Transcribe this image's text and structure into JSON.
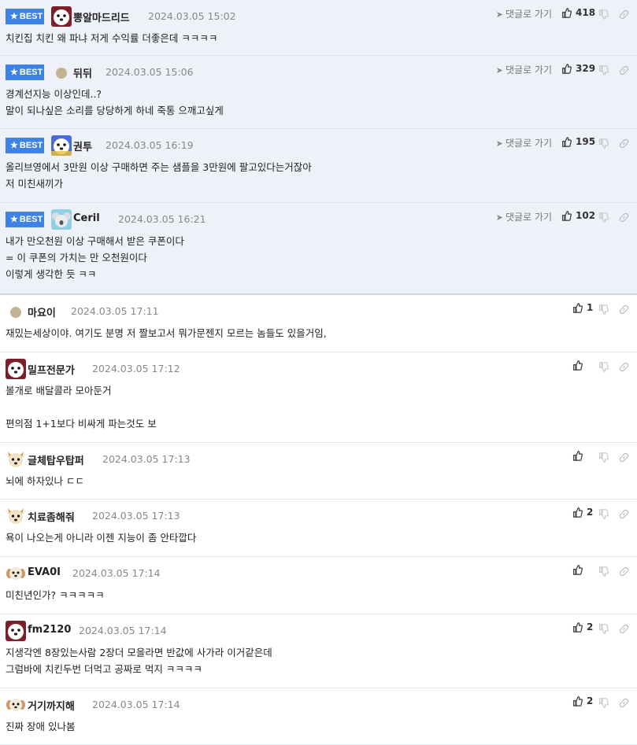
{
  "labels": {
    "best": "BEST",
    "reply": "댓글로 가기"
  },
  "colors": {
    "best_badge": "#3e82e4",
    "best_bg": "#eef2f8"
  },
  "best_comments": [
    {
      "nick": "뽕알마드리드",
      "date": "2024.03.05 15:02",
      "likes": "418",
      "avatar": "dog-avatar-white",
      "body": "치킨집 치킨 왜 파냐 저게 수익률 더좋은데 ㅋㅋㅋㅋ"
    },
    {
      "nick": "뒤뒤",
      "date": "2024.03.05 15:06",
      "likes": "329",
      "avatar": "default-dot-avatar",
      "body": "경계선지능 이상인데..?\n말이 되나싶은 소리를 당당하게 하네 죽통 으깨고싶게"
    },
    {
      "nick": "권투",
      "date": "2024.03.05 16:19",
      "likes": "195",
      "avatar": "dog-avatar-colorful",
      "body": "올리브영에서 3만원 이상 구매하면 주는 샘플을 3만원에 팔고있다는거잖아\n저 미친새끼가"
    },
    {
      "nick": "Ceril",
      "date": "2024.03.05 16:21",
      "likes": "102",
      "avatar": "koala-avatar",
      "body": "내가 만오천원 이상 구매해서 받은 쿠폰이다\n= 이 쿠폰의 가치는 만 오천원이다\n이렇게 생각한 듯 ㅋㅋ"
    }
  ],
  "comments": [
    {
      "nick": "마요이",
      "date": "2024.03.05 17:11",
      "likes": "1",
      "avatar": "default-dot-avatar",
      "body": "재밌는세상이야. 여기도 분명 저 짤보고서 뭐가문젠지 모르는 놈들도 있을거임,"
    },
    {
      "nick": "밀프전문가",
      "date": "2024.03.05 17:12",
      "likes": "",
      "avatar": "dog-avatar-white",
      "body": "볼개로 배달콜라 모아둔거\n\n편의점 1+1보다 비싸게 파는것도 보"
    },
    {
      "nick": "글체탑우탑퍼",
      "date": "2024.03.05 17:13",
      "likes": "",
      "avatar": "shiba-avatar",
      "body": "뇌에 하자있나 ㄷㄷ"
    },
    {
      "nick": "치료좀해줘",
      "date": "2024.03.05 17:13",
      "likes": "2",
      "avatar": "shiba-avatar",
      "body": "욕이 나오는게 아니라 이젠 지능이 좀 안타깝다"
    },
    {
      "nick": "EVA0I",
      "date": "2024.03.05 17:14",
      "likes": "",
      "avatar": "puppy-avatar",
      "body": "미친년인가? ㅋㅋㅋㅋㅋ"
    },
    {
      "nick": "fm2120",
      "date": "2024.03.05 17:14",
      "likes": "2",
      "avatar": "dog-avatar-white",
      "body": "지생각엔 8장있는사람 2장더 모을라면 반값에 사가라 이거같은데\n그럼바에 치킨두번 더먹고 공짜로 먹지 ㅋㅋㅋㅋ"
    },
    {
      "nick": "거기까지해",
      "date": "2024.03.05 17:14",
      "likes": "2",
      "avatar": "puppy-avatar",
      "body": "진짜 장애 있나봄"
    }
  ]
}
